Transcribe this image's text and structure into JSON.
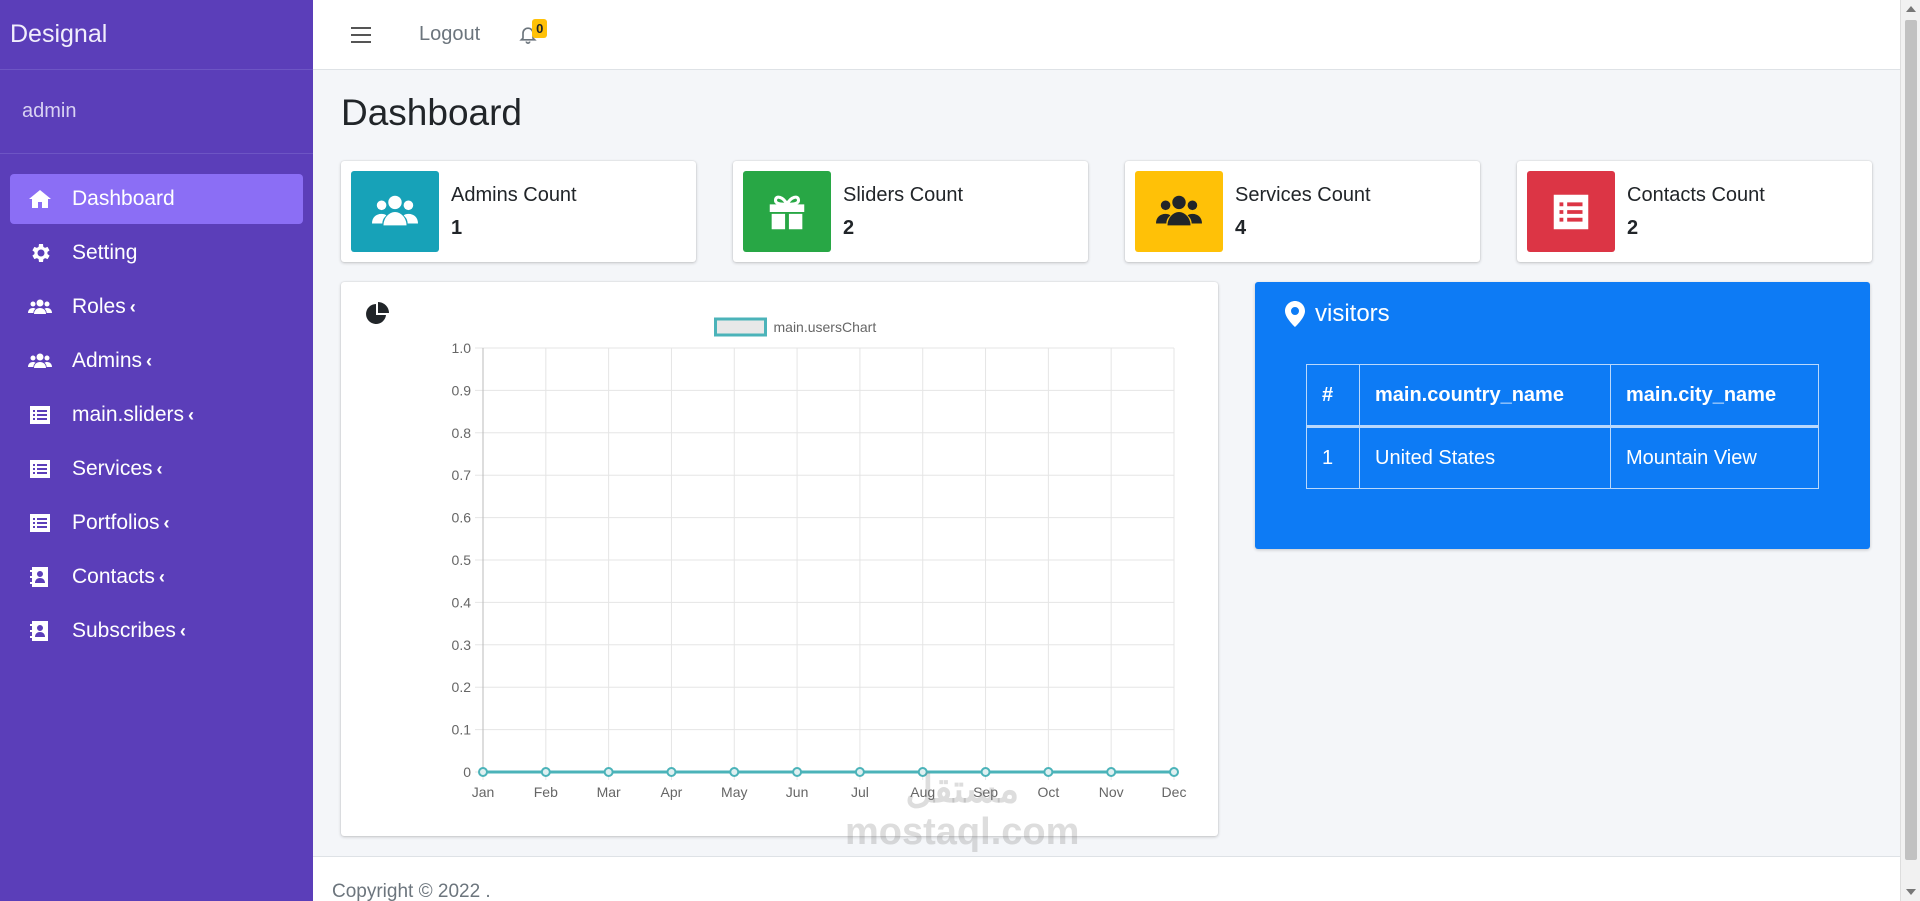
{
  "sidebar": {
    "brand": "Designal",
    "user": "admin",
    "items": [
      {
        "label": "Dashboard",
        "icon": "home-icon",
        "active": true
      },
      {
        "label": "Setting",
        "icon": "gear-icon"
      },
      {
        "label": "Roles",
        "icon": "users-icon",
        "chevron": true
      },
      {
        "label": "Admins",
        "icon": "users-icon",
        "chevron": true
      },
      {
        "label": "main.sliders",
        "icon": "list-icon",
        "chevron": true
      },
      {
        "label": "Services",
        "icon": "list-icon",
        "chevron": true
      },
      {
        "label": "Portfolios",
        "icon": "list-icon",
        "chevron": true
      },
      {
        "label": "Contacts",
        "icon": "contact-icon",
        "chevron": true
      },
      {
        "label": "Subscribes",
        "icon": "contact-icon",
        "chevron": true
      }
    ]
  },
  "topbar": {
    "logout_label": "Logout",
    "notification_count": "0"
  },
  "page": {
    "title": "Dashboard"
  },
  "info_boxes": [
    {
      "label": "Admins Count",
      "value": "1",
      "color": "#17a2b8",
      "icon": "users-icon"
    },
    {
      "label": "Sliders Count",
      "value": "2",
      "color": "#28a745",
      "icon": "gift-icon"
    },
    {
      "label": "Services Count",
      "value": "4",
      "color": "#ffc107",
      "icon": "users-icon"
    },
    {
      "label": "Contacts Count",
      "value": "2",
      "color": "#dc3545",
      "icon": "list-icon"
    }
  ],
  "chart_data": {
    "type": "line",
    "categories": [
      "Jan",
      "Feb",
      "Mar",
      "Apr",
      "May",
      "Jun",
      "Jul",
      "Aug",
      "Sep",
      "Oct",
      "Nov",
      "Dec"
    ],
    "series": [
      {
        "name": "main.usersChart",
        "values": [
          0,
          0,
          0,
          0,
          0,
          0,
          0,
          0,
          0,
          0,
          0,
          0
        ],
        "color": "#4bb3b9"
      }
    ],
    "yticks": [
      "0",
      "0.1",
      "0.2",
      "0.3",
      "0.4",
      "0.5",
      "0.6",
      "0.7",
      "0.8",
      "0.9",
      "1.0"
    ],
    "ylim": [
      0,
      1
    ],
    "grid": true,
    "legend": "top-center"
  },
  "visitors": {
    "title": "visitors",
    "columns": [
      "#",
      "main.country_name",
      "main.city_name"
    ],
    "rows": [
      [
        "1",
        "United States",
        "Mountain View"
      ]
    ]
  },
  "footer": {
    "text": "Copyright © 2022 ."
  },
  "watermark": {
    "line1": "مستقل",
    "line2": "mostaql.com"
  },
  "colors": {
    "sidebar": "#5b3eb9",
    "active_item": "#8b6ef5",
    "visitors_bg": "#0d7bf5"
  }
}
